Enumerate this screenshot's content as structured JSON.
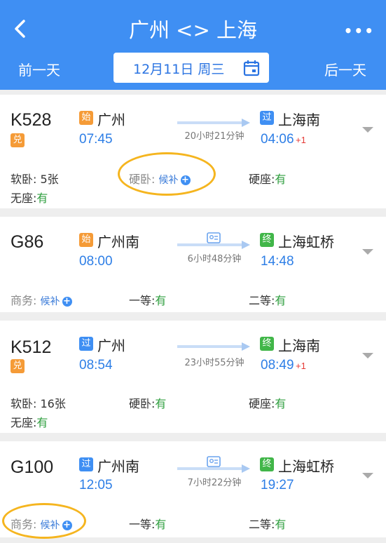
{
  "header": {
    "title": "广州 <> 上海",
    "prev_day": "前一天",
    "next_day": "后一天",
    "date": "12月11日 周三",
    "more": "•••"
  },
  "trains": [
    {
      "number": "K528",
      "ticket_badge": "兑",
      "from_tag": "始",
      "from_station": "广州",
      "depart": "07:45",
      "to_tag": "过",
      "to_station": "上海南",
      "arrive": "04:06",
      "day_offset": "+1",
      "duration": "20小时21分钟",
      "seats": [
        {
          "label": "软卧:",
          "value": "5张"
        },
        {
          "label": "硬卧:",
          "value": "候补"
        },
        {
          "label": "硬座:",
          "value": "有"
        },
        {
          "label": "无座:",
          "value": "有"
        }
      ]
    },
    {
      "number": "G86",
      "from_tag": "始",
      "from_station": "广州南",
      "depart": "08:00",
      "to_tag": "终",
      "to_station": "上海虹桥",
      "arrive": "14:48",
      "duration": "6小时48分钟",
      "seats": [
        {
          "label": "商务:",
          "value": "候补"
        },
        {
          "label": "一等:",
          "value": "有"
        },
        {
          "label": "二等:",
          "value": "有"
        }
      ]
    },
    {
      "number": "K512",
      "ticket_badge": "兑",
      "from_tag": "过",
      "from_station": "广州",
      "depart": "08:54",
      "to_tag": "终",
      "to_station": "上海南",
      "arrive": "08:49",
      "day_offset": "+1",
      "duration": "23小时55分钟",
      "seats": [
        {
          "label": "软卧:",
          "value": "16张"
        },
        {
          "label": "硬卧:",
          "value": "有"
        },
        {
          "label": "硬座:",
          "value": "有"
        },
        {
          "label": "无座:",
          "value": "有"
        }
      ]
    },
    {
      "number": "G100",
      "from_tag": "过",
      "from_station": "广州南",
      "depart": "12:05",
      "to_tag": "终",
      "to_station": "上海虹桥",
      "arrive": "19:27",
      "duration": "7小时22分钟",
      "seats": [
        {
          "label": "商务:",
          "value": "候补"
        },
        {
          "label": "一等:",
          "value": "有"
        },
        {
          "label": "二等:",
          "value": "有"
        }
      ]
    }
  ],
  "colors": {
    "header_bg": "#3f8ff3",
    "time_blue": "#2d7ee6",
    "available_green": "#2e9e3e",
    "waitlist_blue": "#3779d8",
    "highlight": "#f5b51f",
    "tag_start": "#f59b37",
    "tag_pass": "#3f8ff3",
    "tag_end": "#41b649"
  }
}
